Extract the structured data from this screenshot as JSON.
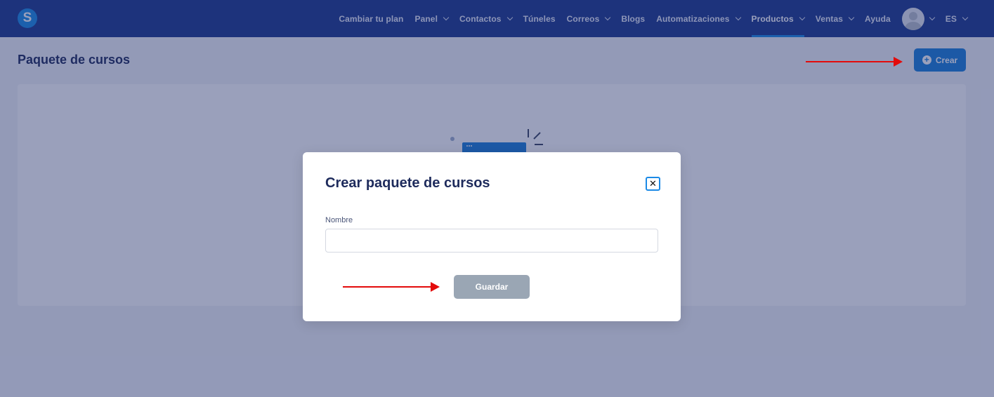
{
  "nav": {
    "items": [
      {
        "label": "Cambiar tu plan",
        "has_dropdown": false
      },
      {
        "label": "Panel",
        "has_dropdown": true
      },
      {
        "label": "Contactos",
        "has_dropdown": true
      },
      {
        "label": "Túneles",
        "has_dropdown": false
      },
      {
        "label": "Correos",
        "has_dropdown": true
      },
      {
        "label": "Blogs",
        "has_dropdown": false
      },
      {
        "label": "Automatizaciones",
        "has_dropdown": true
      },
      {
        "label": "Productos",
        "has_dropdown": true,
        "active": true
      },
      {
        "label": "Ventas",
        "has_dropdown": true
      },
      {
        "label": "Ayuda",
        "has_dropdown": false
      }
    ],
    "language": "ES",
    "logo_letter": "S"
  },
  "page": {
    "title": "Paquete de cursos",
    "create_button": "Crear"
  },
  "modal": {
    "title": "Crear paquete de cursos",
    "close_symbol": "✕",
    "name_label": "Nombre",
    "name_value": "",
    "save_button": "Guardar"
  },
  "colors": {
    "nav_bg": "#1d3a8d",
    "primary": "#1b7fd9",
    "disabled_button": "#9aa6b4",
    "annotation": "#e30b0b"
  }
}
